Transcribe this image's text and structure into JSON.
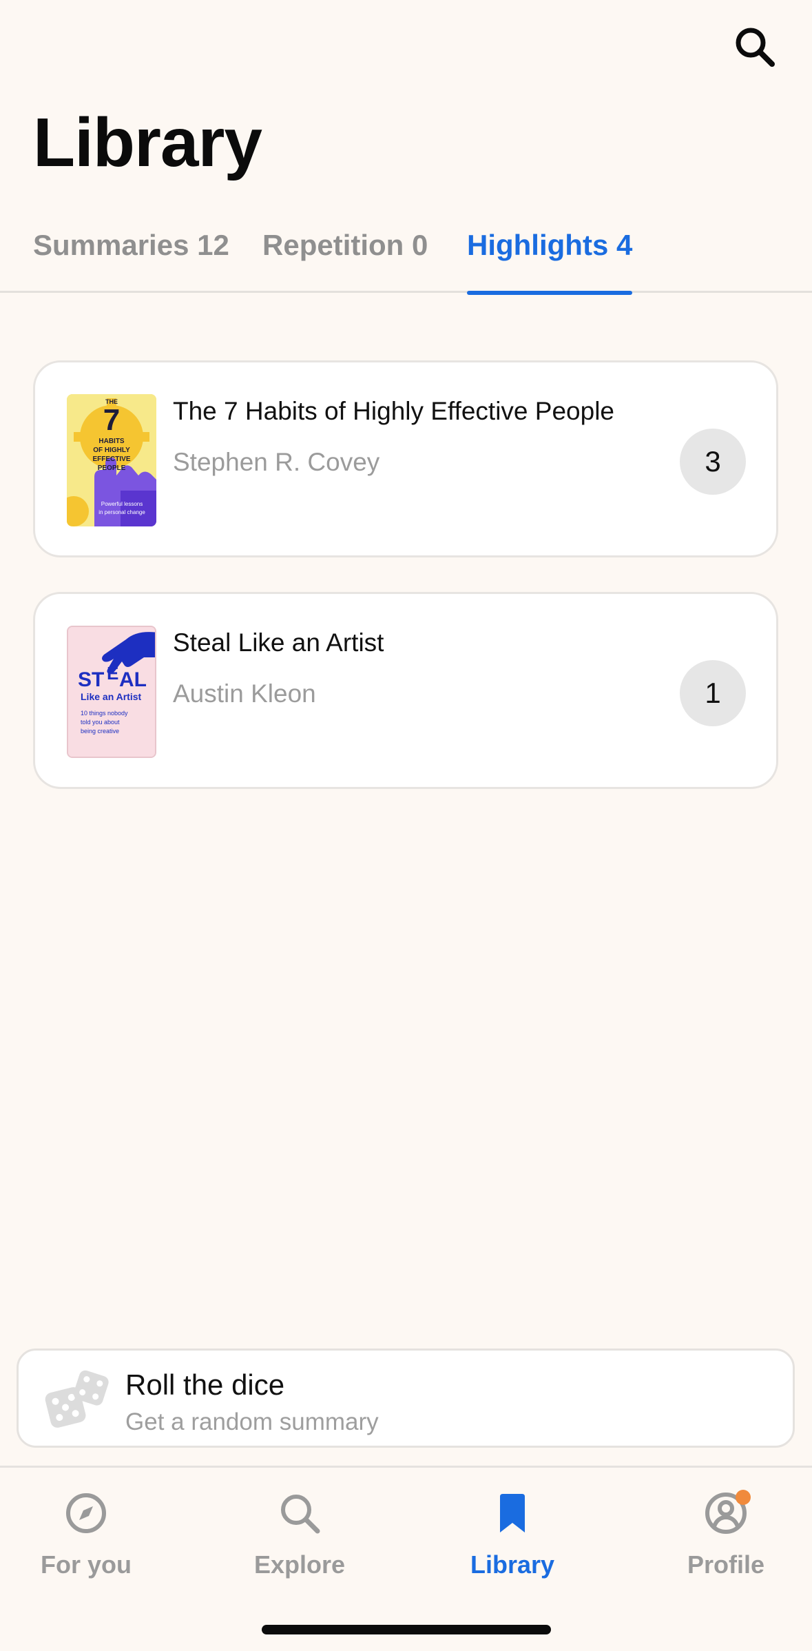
{
  "header": {
    "title": "Library",
    "search_icon": "search-icon"
  },
  "tabs": [
    {
      "label": "Summaries 12",
      "active": false
    },
    {
      "label": "Repetition 0",
      "active": false
    },
    {
      "label": "Highlights 4",
      "active": true
    }
  ],
  "books": [
    {
      "title": "The 7 Habits of Highly Effective People",
      "author": "Stephen R. Covey",
      "highlights": "3",
      "cover": {
        "small_text": "THE",
        "number": "7",
        "line1": "HABITS",
        "line2": "OF HIGHLY",
        "line3": "EFFECTIVE",
        "line4": "PEOPLE",
        "tagline1": "Powerful lessons",
        "tagline2": "in personal change",
        "bg_color": "#f7e98a",
        "accent_color": "#7b55e0"
      }
    },
    {
      "title": "Steal Like an Artist",
      "author": "Austin Kleon",
      "highlights": "1",
      "cover": {
        "headline_a": "ST",
        "headline_e": "E",
        "headline_b": "AL",
        "subtitle": "Like an Artist",
        "line1": "10 things nobody",
        "line2": "told you about",
        "line3": "being creative",
        "bg_color": "#f9dde3",
        "accent_color": "#1d2fc1"
      }
    }
  ],
  "dice": {
    "title": "Roll the dice",
    "subtitle": "Get a random summary",
    "icon": "dice-icon"
  },
  "nav": [
    {
      "label": "For you",
      "icon": "compass-icon",
      "active": false
    },
    {
      "label": "Explore",
      "icon": "search-icon",
      "active": false
    },
    {
      "label": "Library",
      "icon": "bookmark-icon",
      "active": true
    },
    {
      "label": "Profile",
      "icon": "profile-icon",
      "active": false,
      "badge_color": "#f08a3c"
    }
  ],
  "colors": {
    "accent": "#1a6ce0",
    "background": "#fdf8f3",
    "muted": "#9a9a9a"
  }
}
